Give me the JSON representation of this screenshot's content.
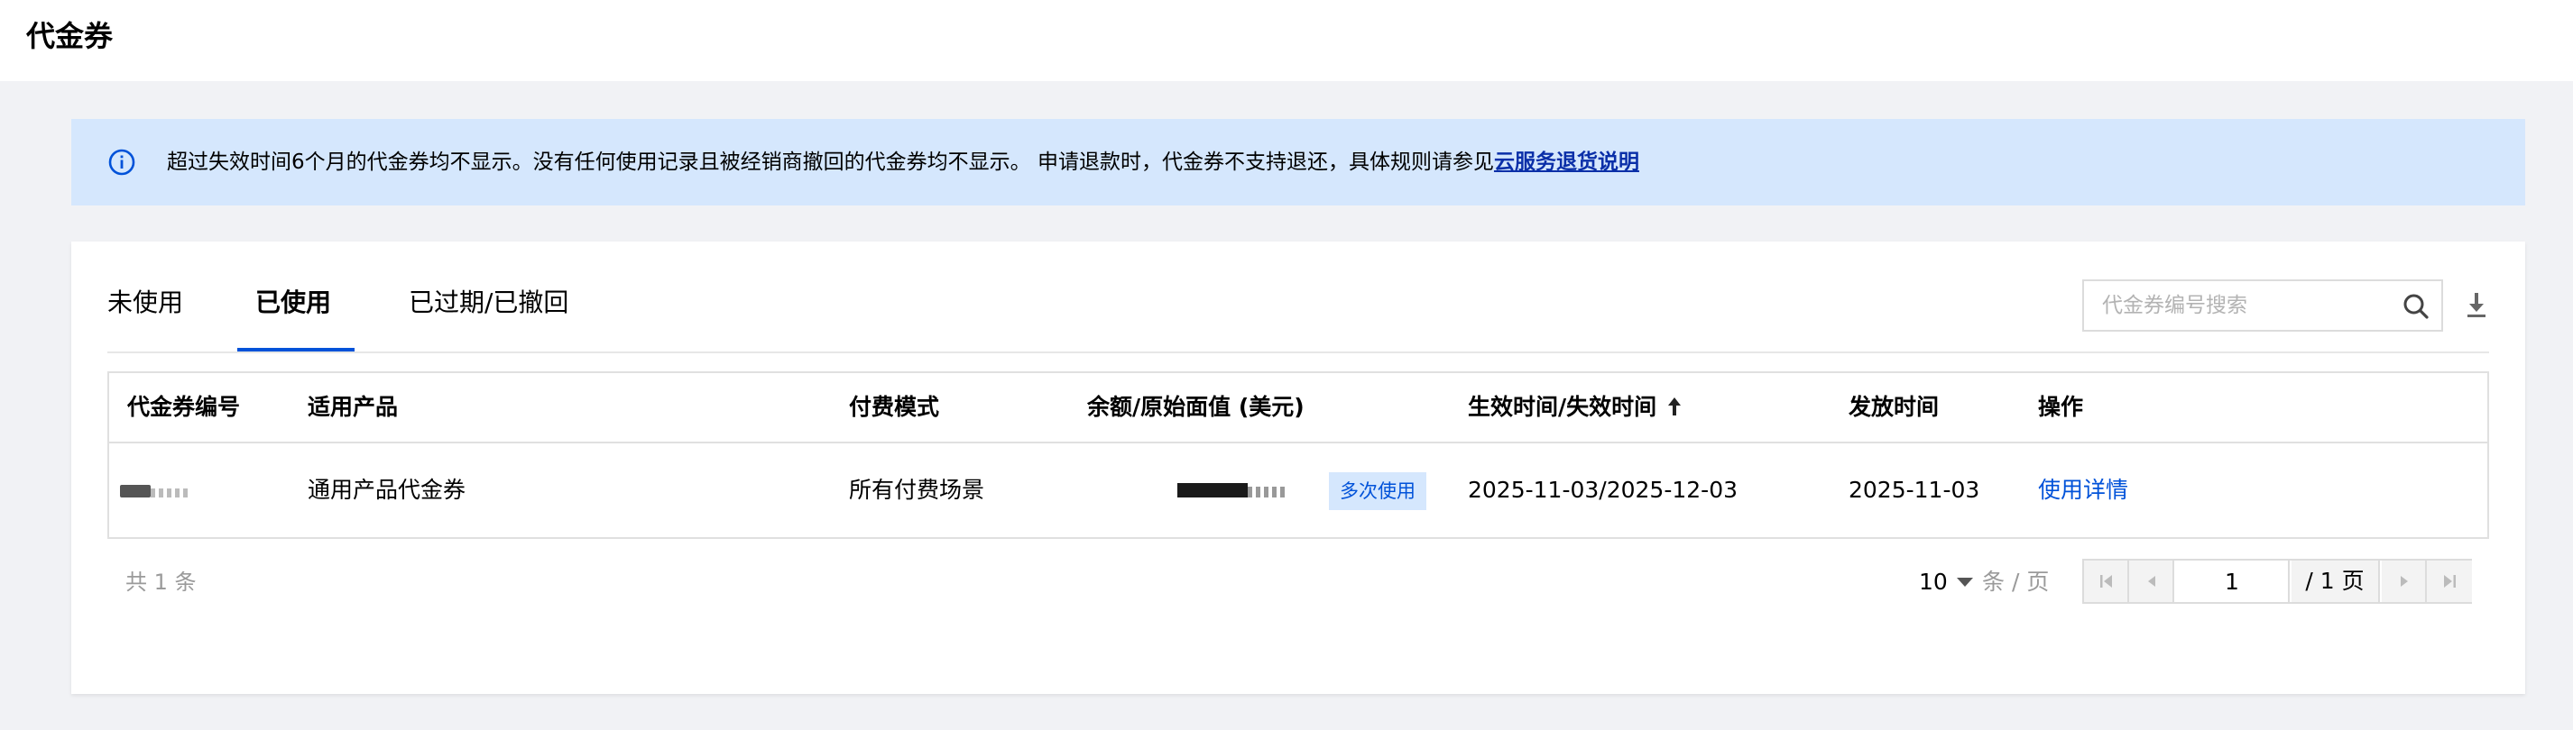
{
  "header": {
    "title": "代金券"
  },
  "notice": {
    "text": "超过失效时间6个月的代金券均不显示。没有任何使用记录且被经销商撤回的代金券均不显示。 申请退款时，代金券不支持退还，具体规则请参见",
    "link": "云服务退货说明"
  },
  "tabs": [
    {
      "label": "未使用"
    },
    {
      "label": "已使用"
    },
    {
      "label": "已过期/已撤回"
    }
  ],
  "active_tab": "已使用",
  "search": {
    "placeholder": "代金券编号搜索",
    "value": ""
  },
  "table": {
    "columns": [
      "代金券编号",
      "适用产品",
      "付费模式",
      "余额/原始面值 (美元)",
      "生效时间/失效时间",
      "发放时间",
      "操作"
    ],
    "rows": [
      {
        "product": "通用产品代金券",
        "payment_mode": "所有付费场景",
        "badge": "多次使用",
        "validity": "2025-11-03/2025-12-03",
        "issued": "2025-11-03",
        "action": "使用详情"
      }
    ]
  },
  "pagination": {
    "total_text": "共 1 条",
    "page_size": "10",
    "page_size_unit": "条 / 页",
    "current_page": "1",
    "total_pages_text": "/ 1 页"
  },
  "colors": {
    "accent": "#0052d9",
    "notice_bg": "#d5e7fd",
    "page_bg": "#f1f2f5"
  }
}
